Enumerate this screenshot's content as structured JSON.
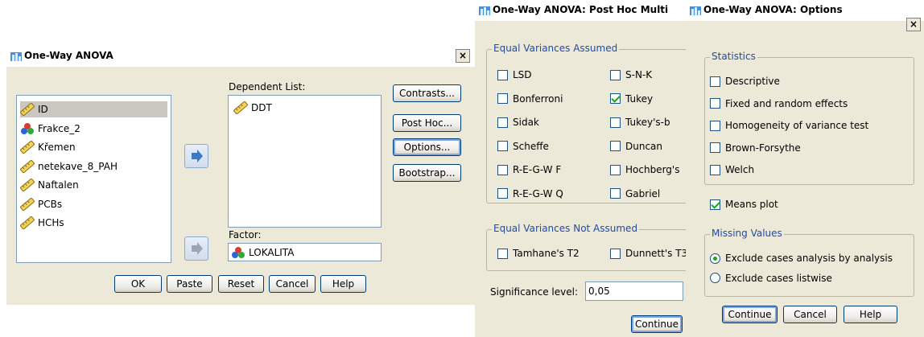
{
  "anova": {
    "title": "One-Way ANOVA",
    "close": "×",
    "variables": [
      {
        "name": "ID",
        "icon": "ruler-icon",
        "selected": true
      },
      {
        "name": "Frakce_2",
        "icon": "nominal-icon"
      },
      {
        "name": "Křemen",
        "icon": "ruler-icon"
      },
      {
        "name": "netekave_8_PAH",
        "icon": "ruler-icon"
      },
      {
        "name": "Naftalen",
        "icon": "ruler-icon"
      },
      {
        "name": "PCBs",
        "icon": "ruler-icon"
      },
      {
        "name": "HCHs",
        "icon": "ruler-icon"
      }
    ],
    "dependent_label": "Dependent List:",
    "dependent_items": [
      {
        "name": "DDT",
        "icon": "ruler-icon"
      }
    ],
    "factor_label": "Factor:",
    "factor_value": "LOKALITA",
    "side_buttons": {
      "contrasts": "Contrasts...",
      "posthoc": "Post Hoc...",
      "options": "Options...",
      "bootstrap": "Bootstrap..."
    },
    "bottom_buttons": {
      "ok": "OK",
      "paste": "Paste",
      "reset": "Reset",
      "cancel": "Cancel",
      "help": "Help"
    }
  },
  "posthoc": {
    "title": "One-Way ANOVA: Post Hoc Multi",
    "equal_group": "Equal Variances Assumed",
    "left": [
      {
        "label": "LSD",
        "checked": false
      },
      {
        "label": "Bonferroni",
        "checked": false
      },
      {
        "label": "Sidak",
        "checked": false
      },
      {
        "label": "Scheffe",
        "checked": false
      },
      {
        "label": "R-E-G-W F",
        "checked": false
      },
      {
        "label": "R-E-G-W Q",
        "checked": false
      }
    ],
    "right": [
      {
        "label": "S-N-K",
        "checked": false
      },
      {
        "label": "Tukey",
        "checked": true
      },
      {
        "label": "Tukey's-b",
        "checked": false
      },
      {
        "label": "Duncan",
        "checked": false
      },
      {
        "label": "Hochberg's",
        "checked": false
      },
      {
        "label": "Gabriel",
        "checked": false
      }
    ],
    "not_equal_group": "Equal Variances Not Assumed",
    "tamhane": "Tamhane's T2",
    "dunnett": "Dunnett's T3",
    "sig_label": "Significance level:",
    "sig_value": "0,05",
    "continue": "Continue"
  },
  "options": {
    "title": "One-Way ANOVA: Options",
    "close": "×",
    "statistics_group": "Statistics",
    "statistics": [
      {
        "label": "Descriptive",
        "checked": false
      },
      {
        "label": "Fixed and random effects",
        "checked": false
      },
      {
        "label": "Homogeneity of variance test",
        "checked": false
      },
      {
        "label": "Brown-Forsythe",
        "checked": false
      },
      {
        "label": "Welch",
        "checked": false
      }
    ],
    "means_plot": "Means plot",
    "missing_group": "Missing Values",
    "missing": [
      {
        "label": "Exclude cases analysis by analysis",
        "checked": true
      },
      {
        "label": "Exclude cases listwise",
        "checked": false
      }
    ],
    "buttons": {
      "continue": "Continue",
      "cancel": "Cancel",
      "help": "Help"
    }
  },
  "colors": {
    "dialog_bg": "#ece9d8",
    "group_title": "#1f4aa8",
    "check_green": "#21a121",
    "button_border": "#003c74"
  }
}
